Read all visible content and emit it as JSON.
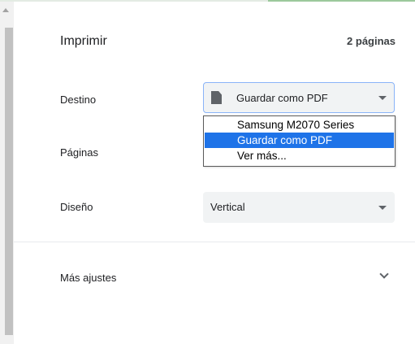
{
  "header": {
    "title": "Imprimir",
    "page_count": "2 páginas"
  },
  "rows": {
    "destination_label": "Destino",
    "pages_label": "Páginas",
    "layout_label": "Diseño"
  },
  "destination": {
    "selected_value": "Guardar como PDF",
    "icon": "document-icon",
    "options": [
      "Samsung M2070 Series",
      "Guardar como PDF",
      "Ver más..."
    ],
    "highlighted_index": 1
  },
  "layout": {
    "selected_value": "Vertical"
  },
  "more_settings": {
    "label": "Más ajustes"
  },
  "colors": {
    "highlight": "#1e73e8",
    "focus_border": "#8ab4f8",
    "select_bg": "#f1f3f4"
  }
}
